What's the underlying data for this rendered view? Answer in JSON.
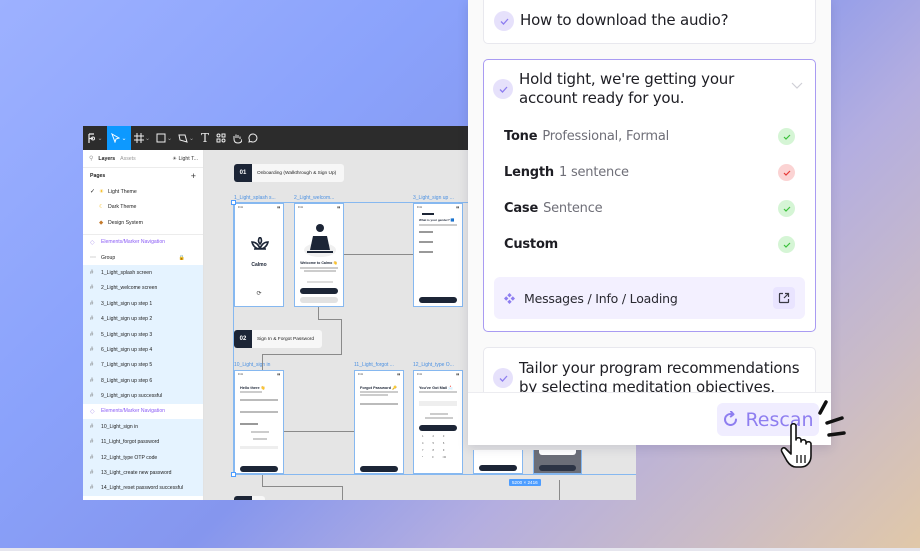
{
  "figma": {
    "toolbar": {
      "tools": [
        {
          "icon": "figma-menu-icon",
          "has_dropdown": true
        },
        {
          "icon": "move-tool-icon",
          "has_dropdown": true,
          "active": true
        },
        {
          "icon": "frame-tool-icon",
          "has_dropdown": true
        },
        {
          "icon": "shape-tool-icon",
          "has_dropdown": true
        },
        {
          "icon": "pen-tool-icon",
          "has_dropdown": true
        },
        {
          "icon": "text-tool-icon",
          "label": "T"
        },
        {
          "icon": "resources-icon"
        },
        {
          "icon": "hand-tool-icon"
        },
        {
          "icon": "comment-tool-icon"
        }
      ],
      "right_tools": [
        "present-frame-icon",
        "component-icon",
        "contrast-icon",
        "boolean-ops-icon"
      ]
    },
    "sidebar": {
      "tabs": {
        "layers": "Layers",
        "assets": "Assets",
        "page_selector": "☀ Light T..."
      },
      "pages_heading": "Pages",
      "pages": [
        {
          "label": "Light Theme",
          "emoji": "☀",
          "selected": true
        },
        {
          "label": "Dark Theme",
          "emoji": "🌙",
          "selected": false
        },
        {
          "label": "Design System",
          "emoji": "🎨",
          "selected": false
        }
      ],
      "layers": [
        {
          "label": "Elements/Marker Navigation",
          "type": "component"
        },
        {
          "label": "Group",
          "type": "group",
          "locked": true
        },
        {
          "label": "1_Light_splash screen",
          "type": "frame"
        },
        {
          "label": "2_Light_welcome screen",
          "type": "frame"
        },
        {
          "label": "3_Light_sign up step 1",
          "type": "frame"
        },
        {
          "label": "4_Light_sign up step 2",
          "type": "frame"
        },
        {
          "label": "5_Light_sign up step 3",
          "type": "frame"
        },
        {
          "label": "6_Light_sign up step 4",
          "type": "frame"
        },
        {
          "label": "7_Light_sign up step 5",
          "type": "frame"
        },
        {
          "label": "8_Light_sign up step 6",
          "type": "frame"
        },
        {
          "label": "9_Light_sign up successful",
          "type": "frame"
        },
        {
          "label": "Elements/Marker Navigation",
          "type": "component"
        },
        {
          "label": "10_Light_sign in",
          "type": "frame"
        },
        {
          "label": "11_Light_forgot password",
          "type": "frame"
        },
        {
          "label": "12_Light_type OTP code",
          "type": "frame"
        },
        {
          "label": "13_Light_create new password",
          "type": "frame"
        },
        {
          "label": "14_Light_reset password successful",
          "type": "frame"
        }
      ]
    },
    "canvas": {
      "sections": [
        {
          "number": "01",
          "title": "Onboarding (Walkthrough & Sign Up)"
        },
        {
          "number": "02",
          "title": "Sign In & Forgot Password"
        }
      ],
      "frame_labels": {
        "f1": "1_Light_splash s...",
        "f2": "2_Light_welcom...",
        "f3": "3_Light_sign up ...",
        "f10": "10_Light_sign in",
        "f11": "11_Light_forgot ...",
        "f12": "12_Light_type O..."
      },
      "frame_content": {
        "splash_app_name": "Calmo",
        "welcome_title": "Welcome to Calmo 👋",
        "gender_title": "What is your gender? 🟦",
        "signin_title": "Hello there 👋",
        "forgot_title": "Forgot Password 🔑",
        "otp_title": "You've Got Mail 📩"
      },
      "selection_size": "5200 × 2416"
    }
  },
  "checker": {
    "items": [
      {
        "text": "How to download the audio?",
        "state": "checked"
      },
      {
        "text": "Hold tight, we're getting your account ready for you.",
        "state": "checked",
        "expanded": true
      },
      {
        "text": "Tailor your program recommendations by selecting meditation objectives.",
        "state": "checked"
      }
    ],
    "rules": [
      {
        "name": "Tone",
        "value": "Professional, Formal",
        "status": "pass",
        "color": "#3cc13c"
      },
      {
        "name": "Length",
        "value": "1 sentence",
        "status": "fail",
        "color": "#e53935"
      },
      {
        "name": "Case",
        "value": "Sentence",
        "status": "pass",
        "color": "#3cc13c"
      },
      {
        "name": "Custom",
        "value": "",
        "status": "pass",
        "color": "#3cc13c"
      }
    ],
    "component_link": "Messages / Info / Loading",
    "rescan_label": "Rescan",
    "accent": "#8e7ef0"
  }
}
